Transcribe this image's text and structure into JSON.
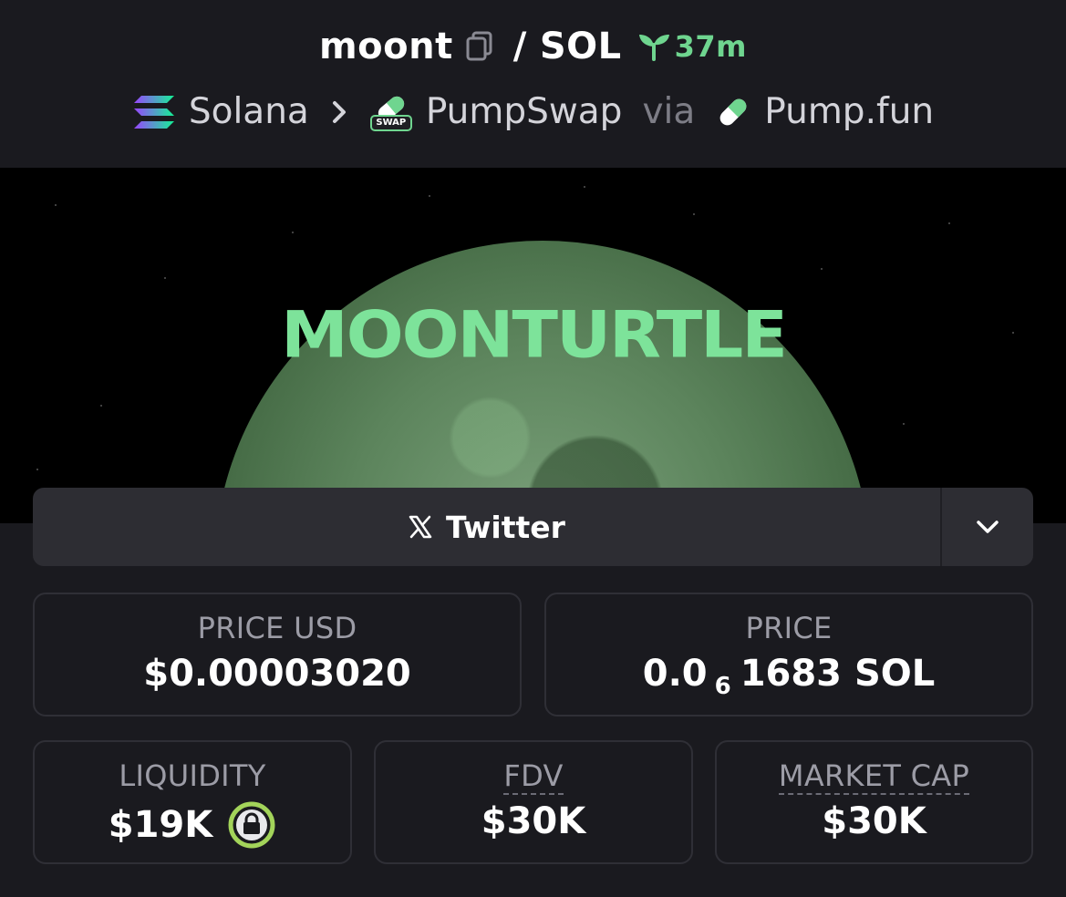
{
  "header": {
    "token_symbol": "moont",
    "separator": "/",
    "quote_symbol": "SOL",
    "age": "37m",
    "breadcrumb": {
      "chain": "Solana",
      "dex": "PumpSwap",
      "dex_badge": "SWAP",
      "via_label": "via",
      "launchpad": "Pump.fun"
    }
  },
  "banner": {
    "title": "MOONTURTLE"
  },
  "social": {
    "twitter_label": "Twitter"
  },
  "stats": {
    "price_usd": {
      "label": "PRICE USD",
      "value": "$0.00003020"
    },
    "price": {
      "label": "PRICE",
      "value_prefix": "0.0",
      "value_subscript": "6",
      "value_suffix": "1683 SOL"
    },
    "liquidity": {
      "label": "LIQUIDITY",
      "value": "$19K"
    },
    "fdv": {
      "label": "FDV",
      "value": "$30K"
    },
    "market_cap": {
      "label": "MARKET CAP",
      "value": "$30K"
    }
  },
  "colors": {
    "background": "#1a1a1f",
    "accent_green": "#6fd58f",
    "banner_text": "#7de39a",
    "lock_ring": "#a3d45a"
  }
}
